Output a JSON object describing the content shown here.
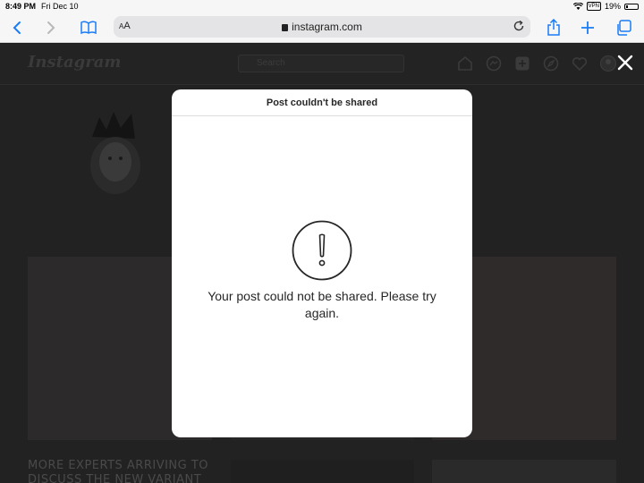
{
  "status_bar": {
    "time": "8:49 PM",
    "date": "Fri Dec 10",
    "vpn": "VPN",
    "battery": "19%",
    "battery_level": 0.19
  },
  "browser": {
    "text_size_small": "A",
    "text_size_large": "A",
    "url": "instagram.com"
  },
  "instagram": {
    "logo": "Instagram",
    "search_placeholder": "Search",
    "headline_line1": "MORE EXPERTS ARRIVING TO",
    "headline_line2": "DISCUSS THE NEW VARIANT"
  },
  "modal": {
    "title": "Post couldn't be shared",
    "message": "Your post could not be shared. Please try again."
  },
  "colors": {
    "safari_blue": "#1a7cf5",
    "overlay": "#222222",
    "modal_bg": "#ffffff"
  }
}
